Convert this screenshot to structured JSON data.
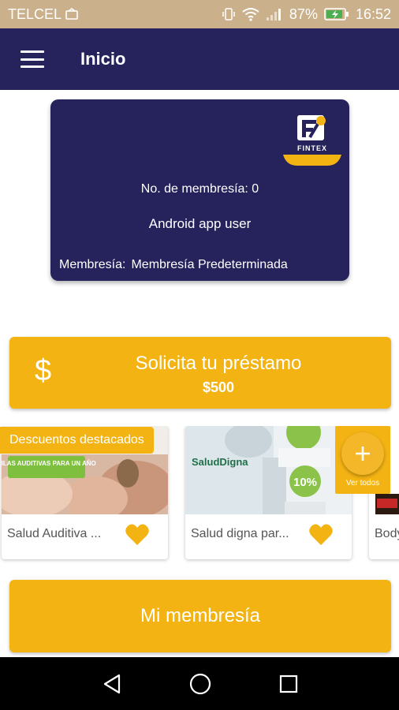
{
  "status_bar": {
    "carrier": "TELCEL",
    "battery": "87%",
    "time": "16:52",
    "icons": [
      "sim-icon",
      "vibrate-icon",
      "wifi-icon",
      "signal-icon",
      "battery-charging-icon"
    ]
  },
  "app_bar": {
    "title": "Inicio",
    "menu_icon": "hamburger-menu-icon"
  },
  "membership_card": {
    "logo_text": "FINTEX",
    "membership_number": "No. de membresía: 0",
    "user_name": "Android app user",
    "membership_label": "Membresía:",
    "membership_value": "Membresía Predeterminada"
  },
  "loan_button": {
    "icon": "$",
    "title": "Solicita tu préstamo",
    "amount": "$500"
  },
  "featured": {
    "badge": "Descuentos destacados",
    "products": [
      {
        "name": "Salud Auditiva ...",
        "image_text": "PILAS AUDITIVAS PARA UN AÑO",
        "icon": "heart-icon"
      },
      {
        "name": "Salud digna par...",
        "image_brand": "SaludDigna",
        "image_percent": "10%",
        "icon": "heart-icon"
      },
      {
        "name": "Body",
        "icon": "heart-icon"
      }
    ],
    "see_all": {
      "label": "Ver todos",
      "icon": "plus-icon"
    }
  },
  "membership_button": {
    "label": "Mi membresía"
  },
  "colors": {
    "primary_navy": "#26235c",
    "accent_yellow": "#f3b312",
    "status_bar": "#cbb08c"
  },
  "nav_bar": {
    "icons": [
      "back-icon",
      "home-icon",
      "recents-icon"
    ]
  }
}
